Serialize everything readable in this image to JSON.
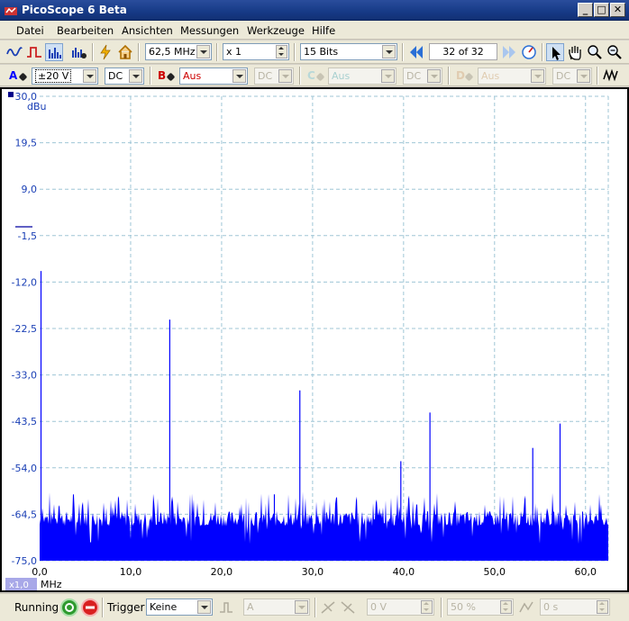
{
  "window": {
    "title": "PicoScope 6 Beta",
    "minimize": "_",
    "maximize": "□",
    "close": "✕"
  },
  "menu": [
    {
      "label": "Datei"
    },
    {
      "label": "Bearbeiten"
    },
    {
      "label": "Ansichten"
    },
    {
      "label": "Messungen"
    },
    {
      "label": "Werkzeuge"
    },
    {
      "label": "Hilfe"
    }
  ],
  "toolbar": {
    "sample_rate": "62,5 MHz",
    "multiplier": "x 1",
    "resolution": "15 Bits",
    "buffer_position": "32 of 32"
  },
  "channels": [
    {
      "letter": "A",
      "color": "#0000ff",
      "range": "±20 V",
      "coupling": "DC",
      "enabled": true
    },
    {
      "letter": "B",
      "color": "#cc0000",
      "range": "Aus",
      "coupling": "DC",
      "enabled": false
    },
    {
      "letter": "C",
      "color": "#7fbfbf",
      "range": "Aus",
      "coupling": "DC",
      "enabled": false
    },
    {
      "letter": "D",
      "color": "#d4b48c",
      "range": "Aus",
      "coupling": "DC",
      "enabled": false
    }
  ],
  "scope": {
    "y_unit": "dBu",
    "x_unit": "MHz",
    "zoom_badge": "x1,0",
    "y_ticks": [
      "30,0",
      "19,5",
      "9,0",
      "-1,5",
      "-12,0",
      "-22,5",
      "-33,0",
      "-43,5",
      "-54,0",
      "-64,5",
      "-75,0"
    ],
    "x_ticks": [
      "0,0",
      "10,0",
      "20,0",
      "30,0",
      "40,0",
      "50,0",
      "60,0"
    ],
    "trace_color": "#0000ff",
    "grid_color": "#9fc6d6"
  },
  "chart_data": {
    "type": "line",
    "xlabel": "MHz",
    "ylabel": "dBu",
    "xlim": [
      0,
      62.5
    ],
    "ylim": [
      -75,
      30
    ],
    "grid": true,
    "series": [
      {
        "peaks": [
          {
            "x": 0.15,
            "y": -9.5
          },
          {
            "x": 14.3,
            "y": -20.5
          },
          {
            "x": 25.8,
            "y": -60.0
          },
          {
            "x": 28.6,
            "y": -36.5
          },
          {
            "x": 39.7,
            "y": -52.5
          },
          {
            "x": 42.9,
            "y": -41.5
          },
          {
            "x": 54.2,
            "y": -49.5
          },
          {
            "x": 57.2,
            "y": -44.0
          }
        ],
        "noise_floor": -65.5
      }
    ]
  },
  "status": {
    "state": "Running",
    "trigger_label": "Trigger",
    "trigger_mode": "Keine",
    "trigger_channel": "A",
    "threshold": "0 V",
    "pre_trigger": "50 %",
    "delay": "0 s"
  }
}
